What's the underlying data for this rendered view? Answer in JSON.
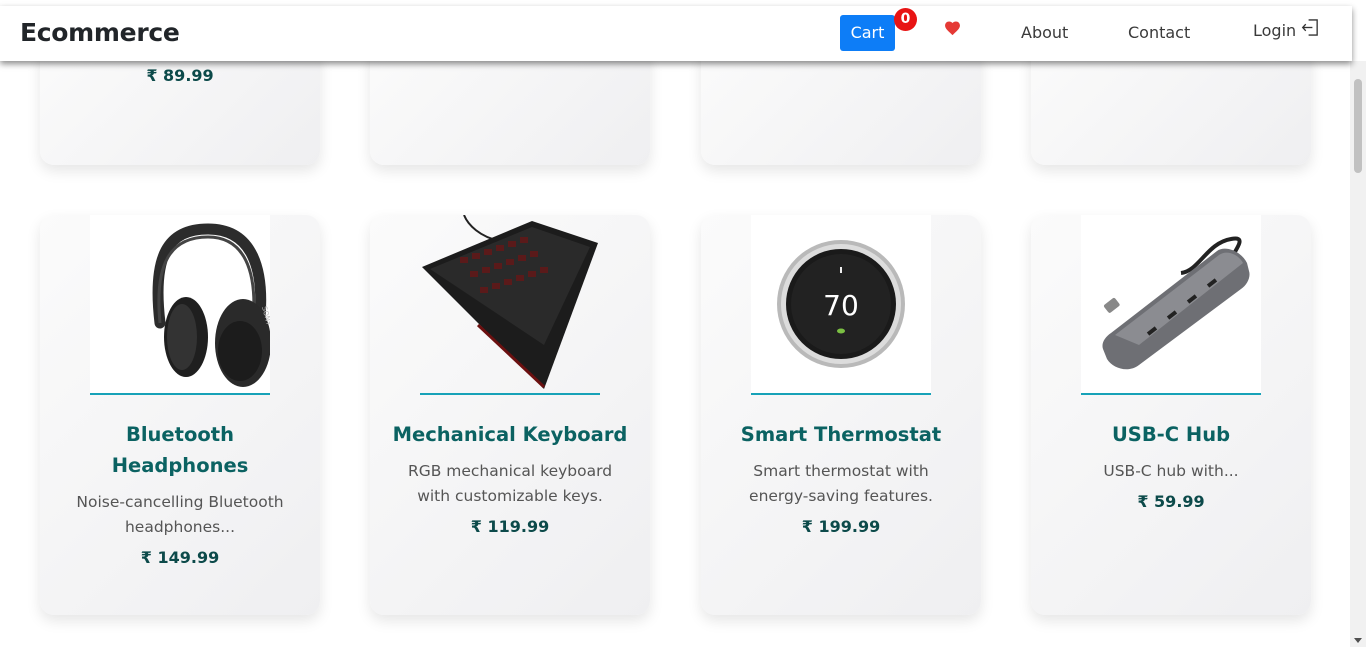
{
  "navbar": {
    "brand": "Ecommerce",
    "cart_label": "Cart",
    "cart_count": "0",
    "links": {
      "about": "About",
      "contact": "Contact",
      "login": "Login"
    }
  },
  "colors": {
    "cart_button": "#0d7df7",
    "badge": "#e81414",
    "heart": "#e53935",
    "title": "#0b6262",
    "accent_line": "#17a2b8"
  },
  "top_row": [
    {
      "price": "₹ 89.99"
    },
    {
      "price": ""
    },
    {
      "price": ""
    },
    {
      "price": ""
    }
  ],
  "products": [
    {
      "image_icon": "headphones-icon",
      "title_line1": "Bluetooth",
      "title_line2": "Headphones",
      "desc_line1": "Noise-cancelling Bluetooth",
      "desc_line2": "headphones...",
      "price": "₹ 149.99"
    },
    {
      "image_icon": "keyboard-icon",
      "title_line1": "Mechanical Keyboard",
      "desc_line1": "RGB mechanical keyboard",
      "desc_line2": "with customizable keys.",
      "price": "₹ 119.99"
    },
    {
      "image_icon": "thermostat-icon",
      "image_text": "70",
      "title_line1": "Smart Thermostat",
      "desc_line1": "Smart thermostat with",
      "desc_line2": "energy-saving features.",
      "price": "₹ 199.99"
    },
    {
      "image_icon": "usb-hub-icon",
      "title_line1": "USB-C Hub",
      "desc_line1": "USB-C hub with...",
      "price": "₹ 59.99"
    }
  ]
}
